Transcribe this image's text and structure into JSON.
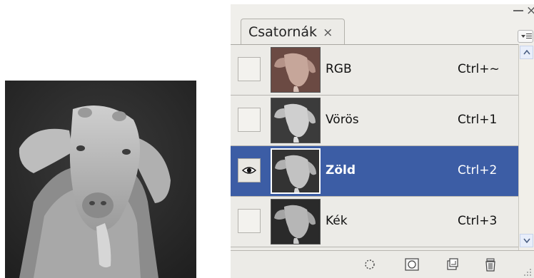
{
  "panel": {
    "tab_label": "Csatornák",
    "tab_close_glyph": "×",
    "window_minimize_glyph": "–",
    "window_close_glyph": "×",
    "menu_icon": "panel-menu-icon"
  },
  "channels": [
    {
      "name": "RGB",
      "shortcut": "Ctrl+~",
      "visible": false,
      "selected": false,
      "tint": "#9e7f74"
    },
    {
      "name": "Vörös",
      "shortcut": "Ctrl+1",
      "visible": false,
      "selected": false,
      "tint": "#707070"
    },
    {
      "name": "Zöld",
      "shortcut": "Ctrl+2",
      "visible": true,
      "selected": true,
      "tint": "#6a6a6a"
    },
    {
      "name": "Kék",
      "shortcut": "Ctrl+3",
      "visible": false,
      "selected": false,
      "tint": "#5e5e5e"
    }
  ],
  "footer_icons": [
    "load-channel-as-selection-icon",
    "save-selection-as-channel-icon",
    "new-channel-icon",
    "delete-channel-icon"
  ],
  "colors": {
    "selected_row": "#3c5da5",
    "panel_bg": "#ecebe7"
  }
}
